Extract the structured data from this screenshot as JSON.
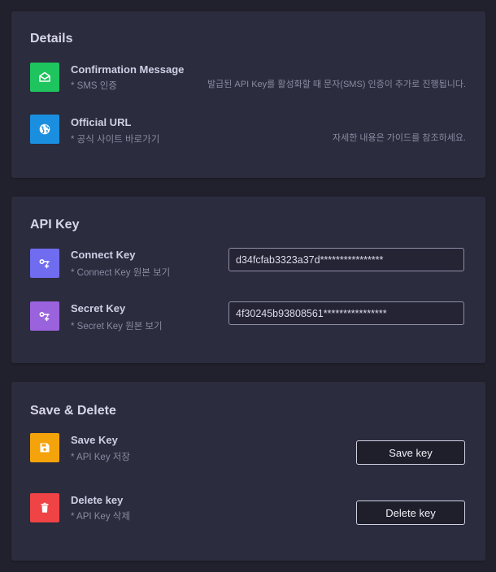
{
  "details": {
    "title": "Details",
    "rows": [
      {
        "title": "Confirmation Message",
        "sub": "* SMS 인증",
        "desc": "발급된 API Key를 활성화할 때 문자(SMS) 인증이 추가로 진행됩니다.",
        "icon": "envelope-open-icon",
        "color": "#1ec45e"
      },
      {
        "title": "Official URL",
        "sub": "* 공식 사이트 바로가기",
        "desc": "자세한 내용은 가이드를 참조하세요.",
        "icon": "globe-icon",
        "color": "#1a8fe0"
      }
    ]
  },
  "api_key": {
    "title": "API Key",
    "rows": [
      {
        "title": "Connect Key",
        "sub": "* Connect Key 원본 보기",
        "value": "d34fcfab3323a37d****************",
        "icon": "key-plus-icon",
        "color": "#6f6cf0"
      },
      {
        "title": "Secret Key",
        "sub": "* Secret Key 원본 보기",
        "value": "4f30245b93808561****************",
        "icon": "key-plus-icon",
        "color": "#9b62de"
      }
    ]
  },
  "save_delete": {
    "title": "Save & Delete",
    "rows": [
      {
        "title": "Save Key",
        "sub": "* API Key 저장",
        "button": "Save key",
        "icon": "floppy-disk-icon",
        "color": "#f5a30a"
      },
      {
        "title": "Delete key",
        "sub": "* API Key 삭제",
        "button": "Delete key",
        "icon": "trash-icon",
        "color": "#ef4346"
      }
    ]
  }
}
